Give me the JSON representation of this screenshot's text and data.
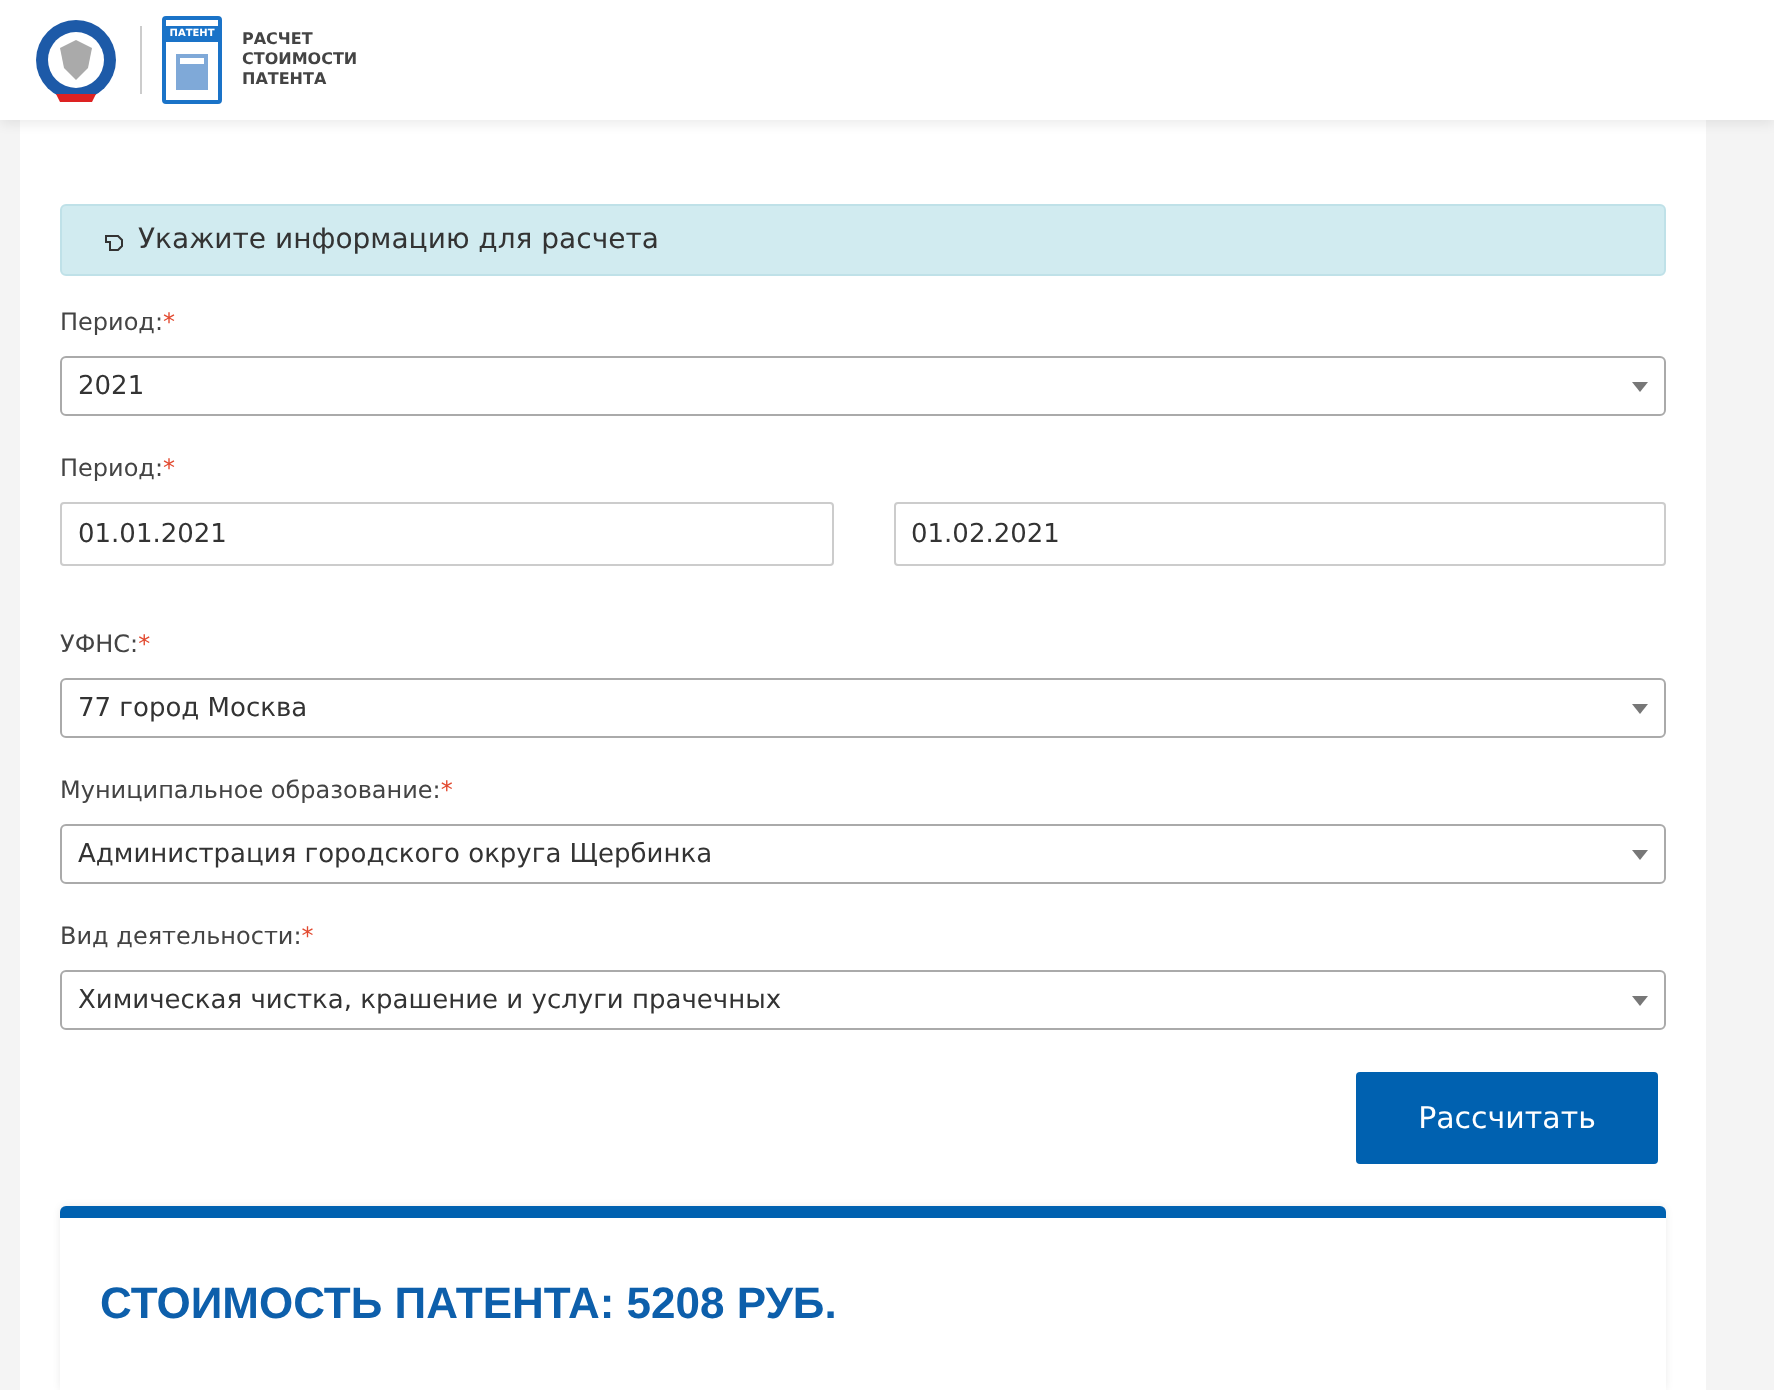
{
  "header": {
    "badge": "ПАТЕНТ",
    "title_lines": [
      "РАСЧЕТ",
      "СТОИМОСТИ",
      "ПАТЕНТА"
    ]
  },
  "info": {
    "text": "Укажите информацию для расчета"
  },
  "fields": [
    {
      "kind": "select",
      "label": "Период:",
      "required_mark": "*",
      "value": "2021"
    },
    {
      "kind": "range",
      "label": "Период:",
      "required_mark": "*",
      "values": [
        "01.01.2021",
        "01.02.2021"
      ]
    },
    {
      "kind": "select",
      "label": "УФНС:",
      "required_mark": "*",
      "value": "77 город Москва"
    },
    {
      "kind": "select",
      "label": "Муниципальное образование:",
      "required_mark": "*",
      "value": "Администрация городского округа Щербинка"
    },
    {
      "kind": "select",
      "label": "Вид деятельности:",
      "required_mark": "*",
      "value": "Химическая чистка, крашение и услуги прачечных"
    }
  ],
  "button": "Рассчитать",
  "result": {
    "text": "СТОИМОСТЬ ПАТЕНТА: 5208 РУБ."
  }
}
